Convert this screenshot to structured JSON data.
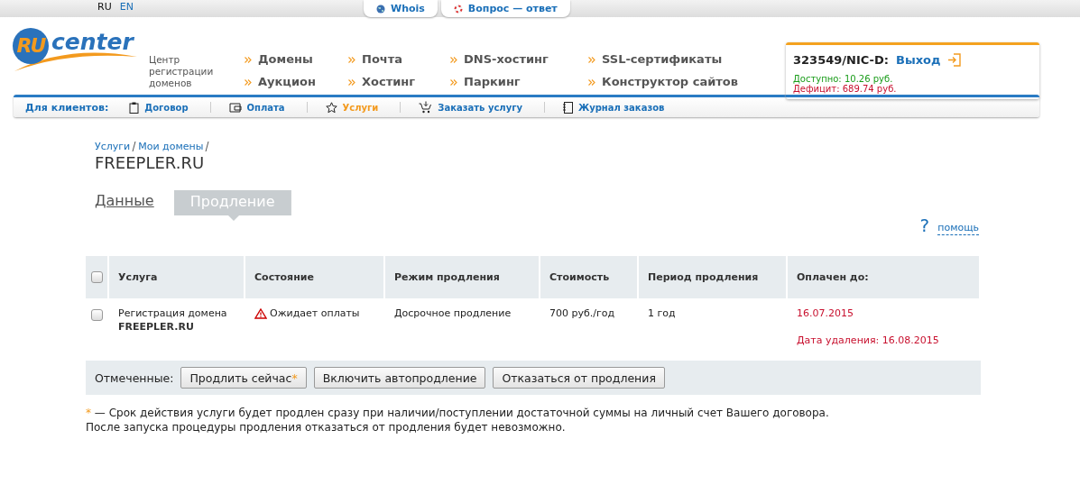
{
  "languages": [
    {
      "label": "RU",
      "selected": true
    },
    {
      "label": "EN",
      "selected": false
    }
  ],
  "top_tabs": [
    {
      "label": "Whois",
      "kind": "globe"
    },
    {
      "label": "Вопрос — ответ",
      "kind": "lifebuoy"
    }
  ],
  "logo": {
    "mark": "RU",
    "word": "center",
    "tagline": "Центр регистрации доменов"
  },
  "main_menu": [
    "Домены",
    "Почта",
    "DNS-хостинг",
    "SSL-сертификаты",
    "Аукцион",
    "Хостинг",
    "Паркинг",
    "Конструктор сайтов"
  ],
  "account": {
    "id": "323549/NIC-D:",
    "logout": "Выход",
    "available": "Доступно: 10.26 руб.",
    "deficit": "Дефицит: 689.74 руб."
  },
  "client_nav": {
    "label": "Для клиентов:",
    "items": [
      {
        "label": "Договор",
        "kind": "clipboard",
        "selected": false
      },
      {
        "label": "Оплата",
        "kind": "wallet",
        "selected": false
      },
      {
        "label": "Услуги",
        "kind": "star",
        "selected": true
      },
      {
        "label": "Заказать услугу",
        "kind": "cart",
        "selected": false
      },
      {
        "label": "Журнал заказов",
        "kind": "notebook",
        "selected": false
      }
    ]
  },
  "breadcrumbs": [
    "Услуги",
    "Мои домены"
  ],
  "title": "FREEPLER.RU",
  "tabs": [
    {
      "label": "Данные",
      "selected": false
    },
    {
      "label": "Продление",
      "selected": true
    }
  ],
  "help": {
    "icon": "?",
    "label": "помощь"
  },
  "table": {
    "select_all_checked": false,
    "columns": [
      "Услуга",
      "Состояние",
      "Режим продления",
      "Стоимость",
      "Период продления",
      "Оплачен до:"
    ],
    "rows": [
      {
        "checked": false,
        "service": "Регистрация домена",
        "domain": "FREEPLER.RU",
        "status": "Ожидает оплаты",
        "mode": "Досрочное продление",
        "cost": "700 руб./год",
        "period": "1 год",
        "paid_until": "16.07.2015",
        "deletion": "Дата удаления: 16.08.2015"
      }
    ]
  },
  "actions": {
    "label": "Отмеченные:",
    "buttons": [
      {
        "label": "Продлить сейчас",
        "marker": "*"
      },
      {
        "label": "Включить автопродление"
      },
      {
        "label": "Отказаться от продления"
      }
    ]
  },
  "footnote": {
    "marker": "*",
    "lines": [
      "— Срок действия услуги будет продлен сразу при наличии/поступлении достаточной суммы на личный счет Вашего договора.",
      "После запуска процедуры продления отказаться от продления будет невозможно."
    ]
  }
}
